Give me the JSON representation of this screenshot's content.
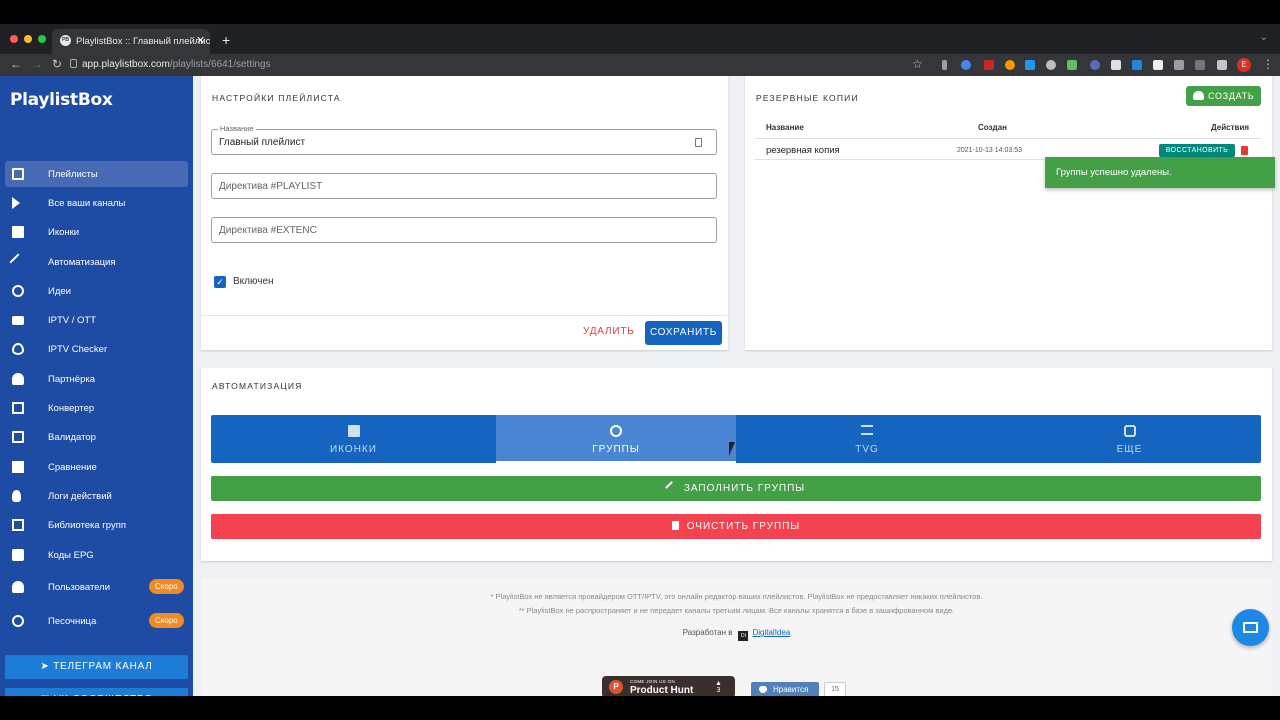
{
  "browser": {
    "tab_title": "PlaylistBox :: Главный плейлист",
    "tab_favicon": "PB",
    "url_host": "app.playlistbox.com",
    "url_path": "/playlists/6641/settings",
    "profile_initial": "E",
    "colors": {
      "titlebar": "#202124",
      "toolbar": "#35363a"
    }
  },
  "sidebar": {
    "brand": "PlaylistBox",
    "items": [
      {
        "label": "Плейлисты",
        "icon": "playlists-icon",
        "active": true
      },
      {
        "label": "Все ваши каналы",
        "icon": "play-icon"
      },
      {
        "label": "Иконки",
        "icon": "image-icon"
      },
      {
        "label": "Автоматизация",
        "icon": "magic-wand-icon"
      },
      {
        "label": "Идеи",
        "icon": "lightbulb-icon"
      },
      {
        "label": "IPTV / OTT",
        "icon": "video-camera-icon"
      },
      {
        "label": "IPTV Checker",
        "icon": "eye-check-icon"
      },
      {
        "label": "Партнёрка",
        "icon": "person-add-icon"
      },
      {
        "label": "Конвертер",
        "icon": "convert-icon"
      },
      {
        "label": "Валидатор",
        "icon": "document-check-icon"
      },
      {
        "label": "Сравнение",
        "icon": "compare-icon"
      },
      {
        "label": "Логи действий",
        "icon": "touch-log-icon"
      },
      {
        "label": "Библиотека групп",
        "icon": "library-icon"
      },
      {
        "label": "Коды EPG",
        "icon": "tv-icon"
      },
      {
        "label": "Пользователи",
        "icon": "users-icon",
        "badge": "Скоро"
      },
      {
        "label": "Песочница",
        "icon": "globe-icon",
        "badge": "Скоро"
      }
    ],
    "telegram_button": "Телеграм канал",
    "vk_button": "VK сообщество",
    "colors": {
      "background": "#1e4ba4",
      "badge": "#f08a24",
      "social": "#1d7dd6"
    }
  },
  "settings_card": {
    "title": "Настройки плейлиста",
    "name_label": "Название",
    "name_value": "Главный плейлист",
    "playlist_directive_placeholder": "Директива #PLAYLIST",
    "extenc_directive_placeholder": "Директива #EXTENC",
    "enabled_label": "Включен",
    "enabled_checked": true,
    "delete_label": "Удалить",
    "save_label": "Сохранить"
  },
  "backups_card": {
    "title": "Резервные копии",
    "create_label": "Создать",
    "columns": {
      "name": "Название",
      "created": "Создан",
      "actions": "Действия"
    },
    "rows": [
      {
        "name": "резервная копия",
        "created": "2021-10-13 14:03:53",
        "restore_label": "Восстановить"
      }
    ]
  },
  "toast": {
    "message": "Группы успешно удалены.",
    "color": "#43a047"
  },
  "automation_card": {
    "title": "Автоматизация",
    "tabs": [
      {
        "label": "Иконки",
        "icon": "image-icon"
      },
      {
        "label": "Группы",
        "icon": "groups-icon",
        "active": true
      },
      {
        "label": "TVG",
        "icon": "list-icon"
      },
      {
        "label": "Еще",
        "icon": "puzzle-icon"
      }
    ],
    "fill_groups_label": "Заполнить группы",
    "clear_groups_label": "Очистить группы",
    "colors": {
      "tabs": "#1565c0",
      "fill": "#43a047",
      "clear": "#f44350"
    }
  },
  "footer": {
    "note1": "* PlaylistBox не является провайдером OTT/IPTV, это онлайн редактор ваших плейлистов. PlaylistBox не предоставляет никаких плейлистов.",
    "note2": "** PlaylistBox не распространяет и не передает каналы третьим лицам. Все каналы хранятся в базе в зашифрованном виде.",
    "developed_by": "Разработан в",
    "developer_logo": "DI",
    "developer_link": "DigitalIdea",
    "ph_small": "COME JOIN US ON",
    "ph_name": "Product Hunt",
    "ph_logo": "P",
    "ph_votes": "3",
    "vk_like_label": "Нравится",
    "vk_like_count": "15"
  }
}
